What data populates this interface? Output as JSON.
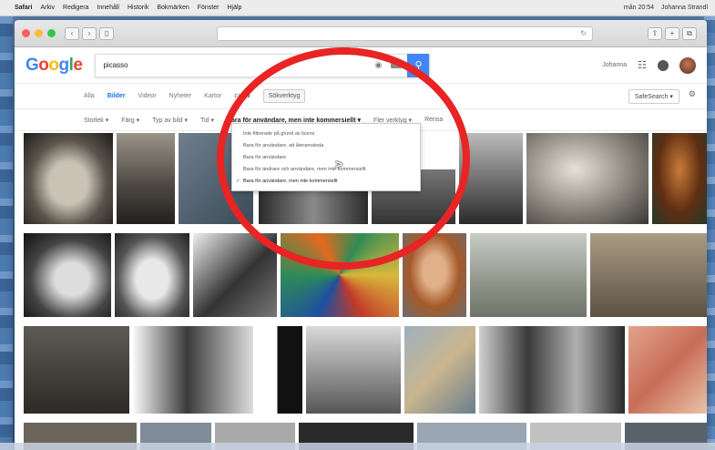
{
  "menubar": {
    "apple": "",
    "items": [
      "Safari",
      "Arkiv",
      "Redigera",
      "Innehåll",
      "Historik",
      "Bokmärken",
      "Fönster",
      "Hjälp"
    ],
    "clock": "mån 20:54",
    "user": "Johanna Strandl"
  },
  "browser": {
    "back": "‹",
    "forward": "›",
    "sidebar": "▯",
    "reload": "↻"
  },
  "google": {
    "logo": {
      "G": "G",
      "o1": "o",
      "o2": "o",
      "g": "g",
      "l": "l",
      "e": "e"
    },
    "query": "picasso",
    "account": "Johanna"
  },
  "tabs": {
    "items": [
      "Alla",
      "Bilder",
      "Videor",
      "Nyheter",
      "Kartor",
      "Fler ▾"
    ],
    "active_index": 1,
    "tools": "Sökverktyg",
    "safesearch": "SafeSearch ▾"
  },
  "filters": {
    "items": [
      "Storlek ▾",
      "Färg ▾",
      "Typ av bild ▾",
      "Tid ▾",
      "Bara för användare, men inte kommersiellt ▾",
      "Fler verktyg ▾",
      "Rensa"
    ],
    "selected_index": 4
  },
  "dropdown": {
    "options": [
      "Inte filtrerade på grund av licens",
      "Bara för användare, att återanvända",
      "Bara för användare",
      "Bara för ändrare och användare, men inte kommersiellt",
      "Bara för användare, men inte kommersiellt"
    ],
    "checked_index": 4
  },
  "colors": {
    "annotation": "#e82424",
    "google_blue": "#4285f4"
  }
}
